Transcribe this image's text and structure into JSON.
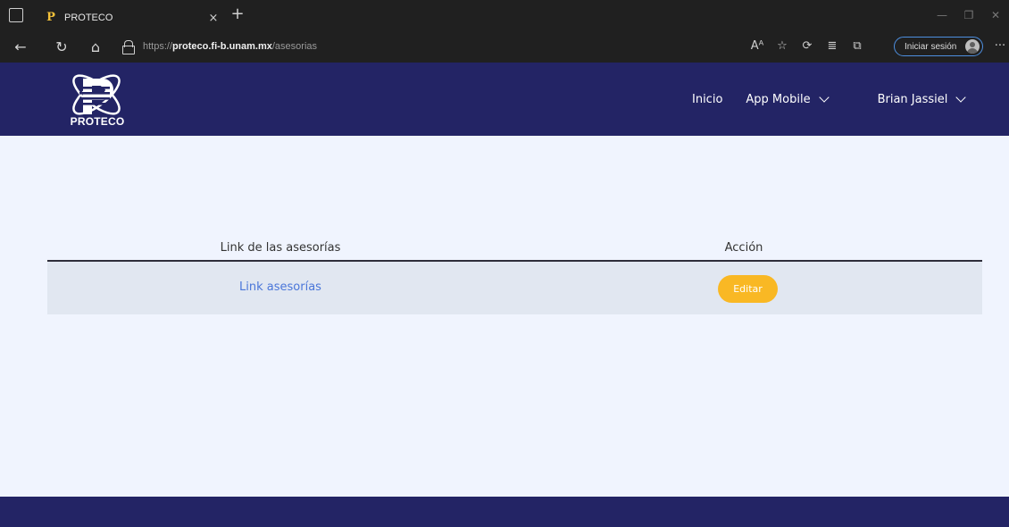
{
  "browser": {
    "tab_title": "PROTECO",
    "tab_favicon": "P",
    "tab_close": "×",
    "new_tab": "+",
    "url_scheme": "https://",
    "url_domain": "proteco.fi-b.unam.mx",
    "url_path": "/asesorias",
    "read_aloud": "Aᴬ",
    "signin_label": "Iniciar sesión",
    "more_label": "···"
  },
  "header": {
    "logo_text": "PROTECO",
    "nav": {
      "inicio": "Inicio",
      "app_mobile": "App Mobile",
      "user": "Brian Jassiel"
    }
  },
  "table": {
    "headers": [
      "Link de las asesorías",
      "Acción"
    ],
    "rows": [
      {
        "link_label": "Link asesorías",
        "action_label": "Editar"
      }
    ]
  },
  "colors": {
    "header_bg": "#232465",
    "page_bg": "#f0f4fe",
    "row_bg": "#e1e7f1",
    "link": "#4a76d9",
    "edit_button": "#f9b824"
  }
}
